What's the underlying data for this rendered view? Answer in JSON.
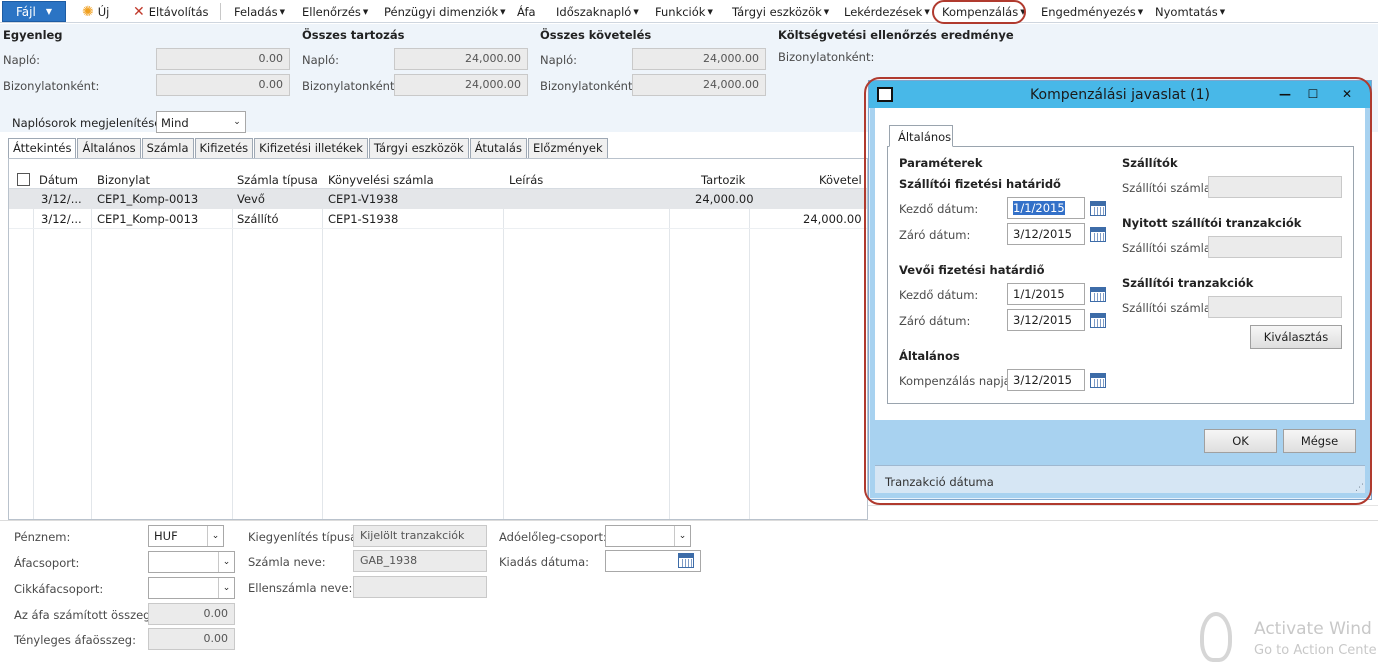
{
  "menu": {
    "file": "Fájl",
    "new": "Új",
    "remove": "Eltávolítás",
    "items": [
      "Feladás",
      "Ellenőrzés",
      "Pénzügyi dimenziók",
      "Áfa",
      "Időszaknapló",
      "Funkciók",
      "Tárgyi eszközök",
      "Lekérdezések",
      "Kompenzálás",
      "Engedményezés",
      "Nyomtatás"
    ]
  },
  "summary": {
    "balance": {
      "title": "Egyenleg",
      "journal_label": "Napló:",
      "journal_value": "0.00",
      "voucher_label": "Bizonylatonként:",
      "voucher_value": "0.00"
    },
    "debit": {
      "title": "Összes tartozás",
      "journal_label": "Napló:",
      "journal_value": "24,000.00",
      "voucher_label": "Bizonylatonként:",
      "voucher_value": "24,000.00"
    },
    "credit": {
      "title": "Összes követelés",
      "journal_label": "Napló:",
      "journal_value": "24,000.00",
      "voucher_label": "Bizonylatonként:",
      "voucher_value": "24,000.00"
    },
    "budget": {
      "title": "Költségvetési ellenőrzés eredménye",
      "voucher_label": "Bizonylatonként:"
    }
  },
  "show_lines": {
    "label": "Naplósorok megjelenítése:",
    "value": "Mind"
  },
  "tabs": [
    "Áttekintés",
    "Általános",
    "Számla",
    "Kifizetés",
    "Kifizetési illetékek",
    "Tárgyi eszközök",
    "Átutalás",
    "Előzmények"
  ],
  "grid": {
    "headers": [
      "Dátum",
      "Bizonylat",
      "Számla típusa",
      "Könyvelési számla",
      "Leírás",
      "Tartozik",
      "Követel"
    ],
    "rows": [
      {
        "date": "3/12/...",
        "voucher": "CEP1_Komp-0013",
        "type": "Vevő",
        "account": "CEP1-V1938",
        "desc": "",
        "debit": "24,000.00",
        "credit": ""
      },
      {
        "date": "3/12/...",
        "voucher": "CEP1_Komp-0013",
        "type": "Szállító",
        "account": "CEP1-S1938",
        "desc": "",
        "debit": "",
        "credit": "24,000.00"
      }
    ]
  },
  "bottom": {
    "currency_label": "Pénznem:",
    "currency_value": "HUF",
    "vat_group_label": "Áfacsoport:",
    "item_vat_label": "Cikkáfacsoport:",
    "calc_vat_label": "Az áfa számított összege:",
    "calc_vat_value": "0.00",
    "actual_vat_label": "Tényleges áfaösszeg:",
    "actual_vat_value": "0.00",
    "settle_type_label": "Kiegyenlítés típusa:",
    "settle_type_value": "Kijelölt tranzakciók",
    "account_name_label": "Számla neve:",
    "account_name_value": "GAB_1938",
    "offset_name_label": "Ellenszámla neve:",
    "tax_prepay_label": "Adóelőleg-csoport:",
    "issue_date_label": "Kiadás dátuma:"
  },
  "dialog": {
    "title": "Kompenzálási javaslat (1)",
    "tab": "Általános",
    "params_title": "Paraméterek",
    "vendor_due_title": "Szállítói fizetési határidő",
    "vendor_from_label": "Kezdő dátum:",
    "vendor_from_value": "1/1/2015",
    "vendor_to_label": "Záró dátum:",
    "vendor_to_value": "3/12/2015",
    "customer_due_title": "Vevői fizetési határdiő",
    "customer_from_label": "Kezdő dátum:",
    "customer_from_value": "1/1/2015",
    "customer_to_label": "Záró dátum:",
    "customer_to_value": "3/12/2015",
    "general_title": "Általános",
    "comp_day_label": "Kompenzálás napja:",
    "comp_day_value": "3/12/2015",
    "vendors_title": "Szállítók",
    "vendor_account_label": "Szállítói számla:",
    "open_tx_title": "Nyitott szállítói tranzakciók",
    "open_tx_account_label": "Szállítói számla:",
    "vendor_tx_title": "Szállítói tranzakciók",
    "vendor_tx_account_label": "Szállítói számla:",
    "select_button": "Kiválasztás",
    "ok_button": "OK",
    "cancel_button": "Mégse",
    "status": "Tranzakció dátuma"
  },
  "watermark": {
    "line1": "Activate Wind",
    "line2": "Go to Action Cente"
  },
  "colors": {
    "accent": "#2b74c4",
    "highlight": "#b03a2e",
    "titlebar": "#48b8e8"
  }
}
